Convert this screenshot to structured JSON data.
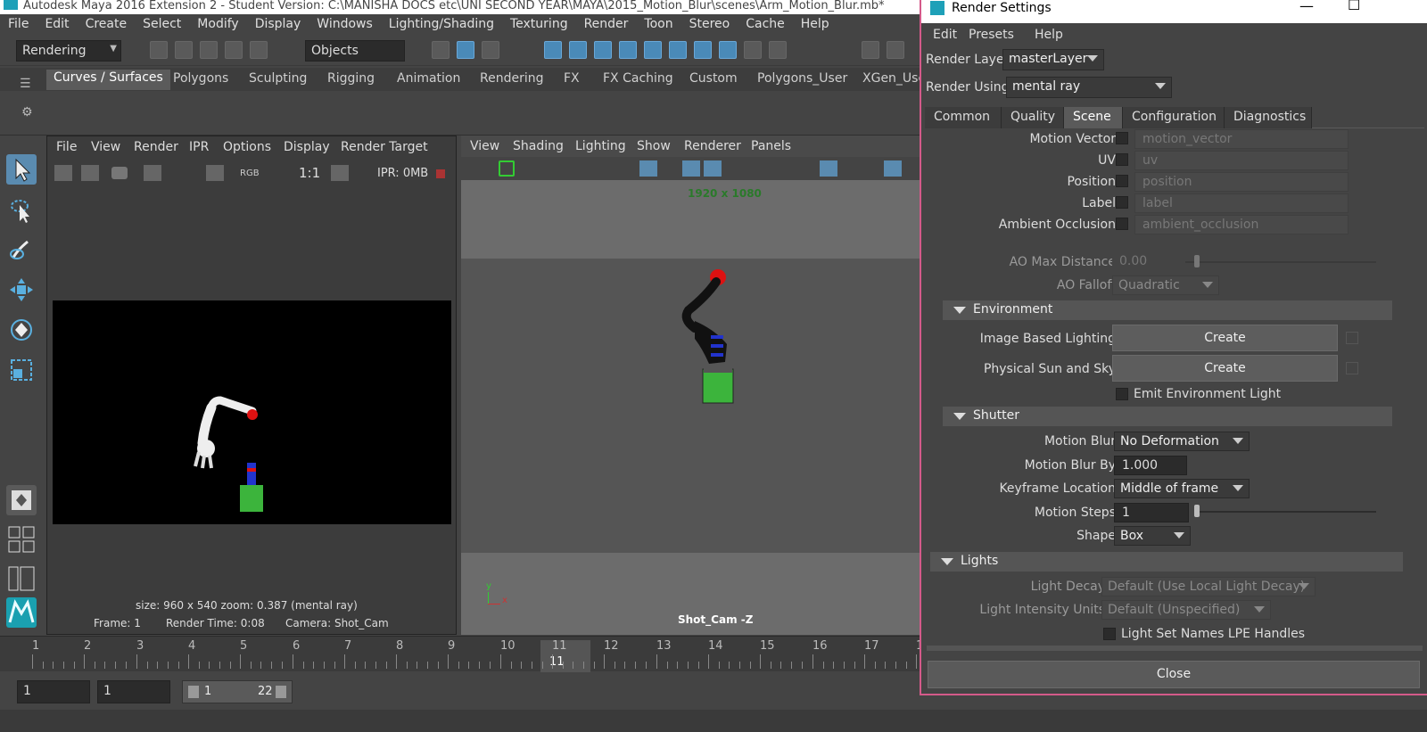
{
  "app": {
    "title": "Autodesk Maya 2016 Extension 2 - Student Version: C:\\MANISHA DOCS etc\\UNI SECOND YEAR\\MAYA\\2015_Motion_Blur\\scenes\\Arm_Motion_Blur.mb*"
  },
  "menubar": [
    "File",
    "Edit",
    "Create",
    "Select",
    "Modify",
    "Display",
    "Windows",
    "Lighting/Shading",
    "Texturing",
    "Render",
    "Toon",
    "Stereo",
    "Cache",
    "Help"
  ],
  "toolbar": {
    "menuset": "Rendering",
    "objects_field": "Objects"
  },
  "shelf_tabs": [
    "Curves / Surfaces",
    "Polygons",
    "Sculpting",
    "Rigging",
    "Animation",
    "Rendering",
    "FX",
    "FX Caching",
    "Custom",
    "Polygons_User",
    "XGen_Use"
  ],
  "render_view": {
    "menu": [
      "File",
      "View",
      "Render",
      "IPR",
      "Options",
      "Display",
      "Render Target"
    ],
    "ratio": "1:1",
    "ipr_mem": "IPR: 0MB",
    "rgb_label": "RGB",
    "info_line1": "size: 960 x 540  zoom: 0.387       (mental ray)",
    "frame": "Frame: 1",
    "render_time": "Render Time: 0:08",
    "camera": "Camera: Shot_Cam"
  },
  "viewport": {
    "menu": [
      "View",
      "Shading",
      "Lighting",
      "Show",
      "Renderer",
      "Panels"
    ],
    "resolution": "1920 x 1080",
    "camera_label": "Shot_Cam -Z",
    "axis_y": "y",
    "axis_x": "x"
  },
  "timeline": {
    "ticks": [
      "1",
      "2",
      "3",
      "4",
      "5",
      "6",
      "7",
      "8",
      "9",
      "10",
      "11",
      "12",
      "13",
      "14",
      "15",
      "16",
      "17",
      "1"
    ],
    "current": "11"
  },
  "range": {
    "start": "1",
    "playback_start": "1",
    "slider_start": "1",
    "slider_end": "22"
  },
  "render_settings": {
    "title": "Render Settings",
    "menu": [
      "Edit",
      "Presets",
      "Help"
    ],
    "render_layer_label": "Render Layer",
    "render_layer": "masterLayer",
    "render_using_label": "Render Using",
    "render_using": "mental ray",
    "tabs": [
      "Common",
      "Quality",
      "Scene",
      "Configuration",
      "Diagnostics"
    ],
    "passes": [
      {
        "label": "Motion Vector",
        "value": "motion_vector"
      },
      {
        "label": "UV",
        "value": "uv"
      },
      {
        "label": "Position",
        "value": "position"
      },
      {
        "label": "Label",
        "value": "label"
      },
      {
        "label": "Ambient Occlusion",
        "value": "ambient_occlusion"
      }
    ],
    "ao_max_label": "AO Max Distance",
    "ao_max": "0.00",
    "ao_falloff_label": "AO Falloff",
    "ao_falloff": "Quadratic",
    "environment": {
      "header": "Environment",
      "ibl_label": "Image Based Lighting",
      "ibl_button": "Create",
      "sun_label": "Physical Sun and Sky",
      "sun_button": "Create",
      "emit_label": "Emit Environment Light"
    },
    "shutter": {
      "header": "Shutter",
      "motion_blur_label": "Motion Blur",
      "motion_blur": "No Deformation",
      "motion_blur_by_label": "Motion Blur By",
      "motion_blur_by": "1.000",
      "keyframe_label": "Keyframe Location",
      "keyframe": "Middle of frame",
      "steps_label": "Motion Steps",
      "steps": "1",
      "shape_label": "Shape",
      "shape": "Box"
    },
    "lights": {
      "header": "Lights",
      "decay_label": "Light Decay",
      "decay": "Default (Use Local Light Decay)",
      "units_label": "Light Intensity Units",
      "units": "Default (Unspecified)",
      "lpe_label": "Light Set Names LPE Handles"
    },
    "close": "Close"
  },
  "colors": {
    "accent": "#5a8bb0",
    "window_border": "#d45a8a",
    "resolution_text": "#2a7a2a"
  }
}
